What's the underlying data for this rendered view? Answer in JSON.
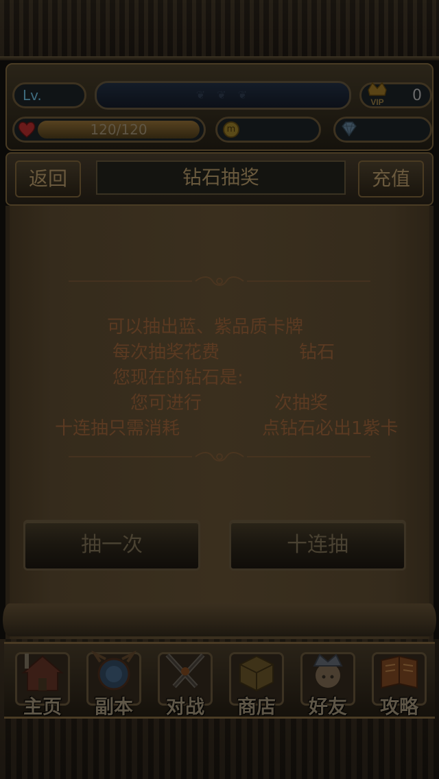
{
  "status": {
    "level_label": "Lv.",
    "vip_label": "VIP",
    "vip_value": "0",
    "stamina": "120/120",
    "stamina_fraction": 1.0,
    "gold": "",
    "diamonds": ""
  },
  "header": {
    "back_label": "返回",
    "title": "钻石抽奖",
    "recharge_label": "充值"
  },
  "info": {
    "line1": "可以抽出蓝、紫品质卡牌",
    "line2_a": "每次抽奖花费",
    "line2_b": "钻石",
    "line3": "您现在的钻石是:",
    "line4_a": "您可进行",
    "line4_b": "次抽奖",
    "line5_a": "十连抽只需消耗",
    "line5_b": "点钻石必出1紫卡"
  },
  "actions": {
    "draw_once": "抽一次",
    "draw_ten": "十连抽"
  },
  "nav": [
    {
      "label": "主页",
      "icon": "home-icon"
    },
    {
      "label": "副本",
      "icon": "dungeon-icon"
    },
    {
      "label": "对战",
      "icon": "battle-icon"
    },
    {
      "label": "商店",
      "icon": "shop-icon"
    },
    {
      "label": "好友",
      "icon": "friends-icon"
    },
    {
      "label": "攻略",
      "icon": "guide-icon"
    }
  ],
  "colors": {
    "parchment": "#3a2f1e",
    "info_text": "#5b3a22",
    "frame": "#4a3c24"
  }
}
